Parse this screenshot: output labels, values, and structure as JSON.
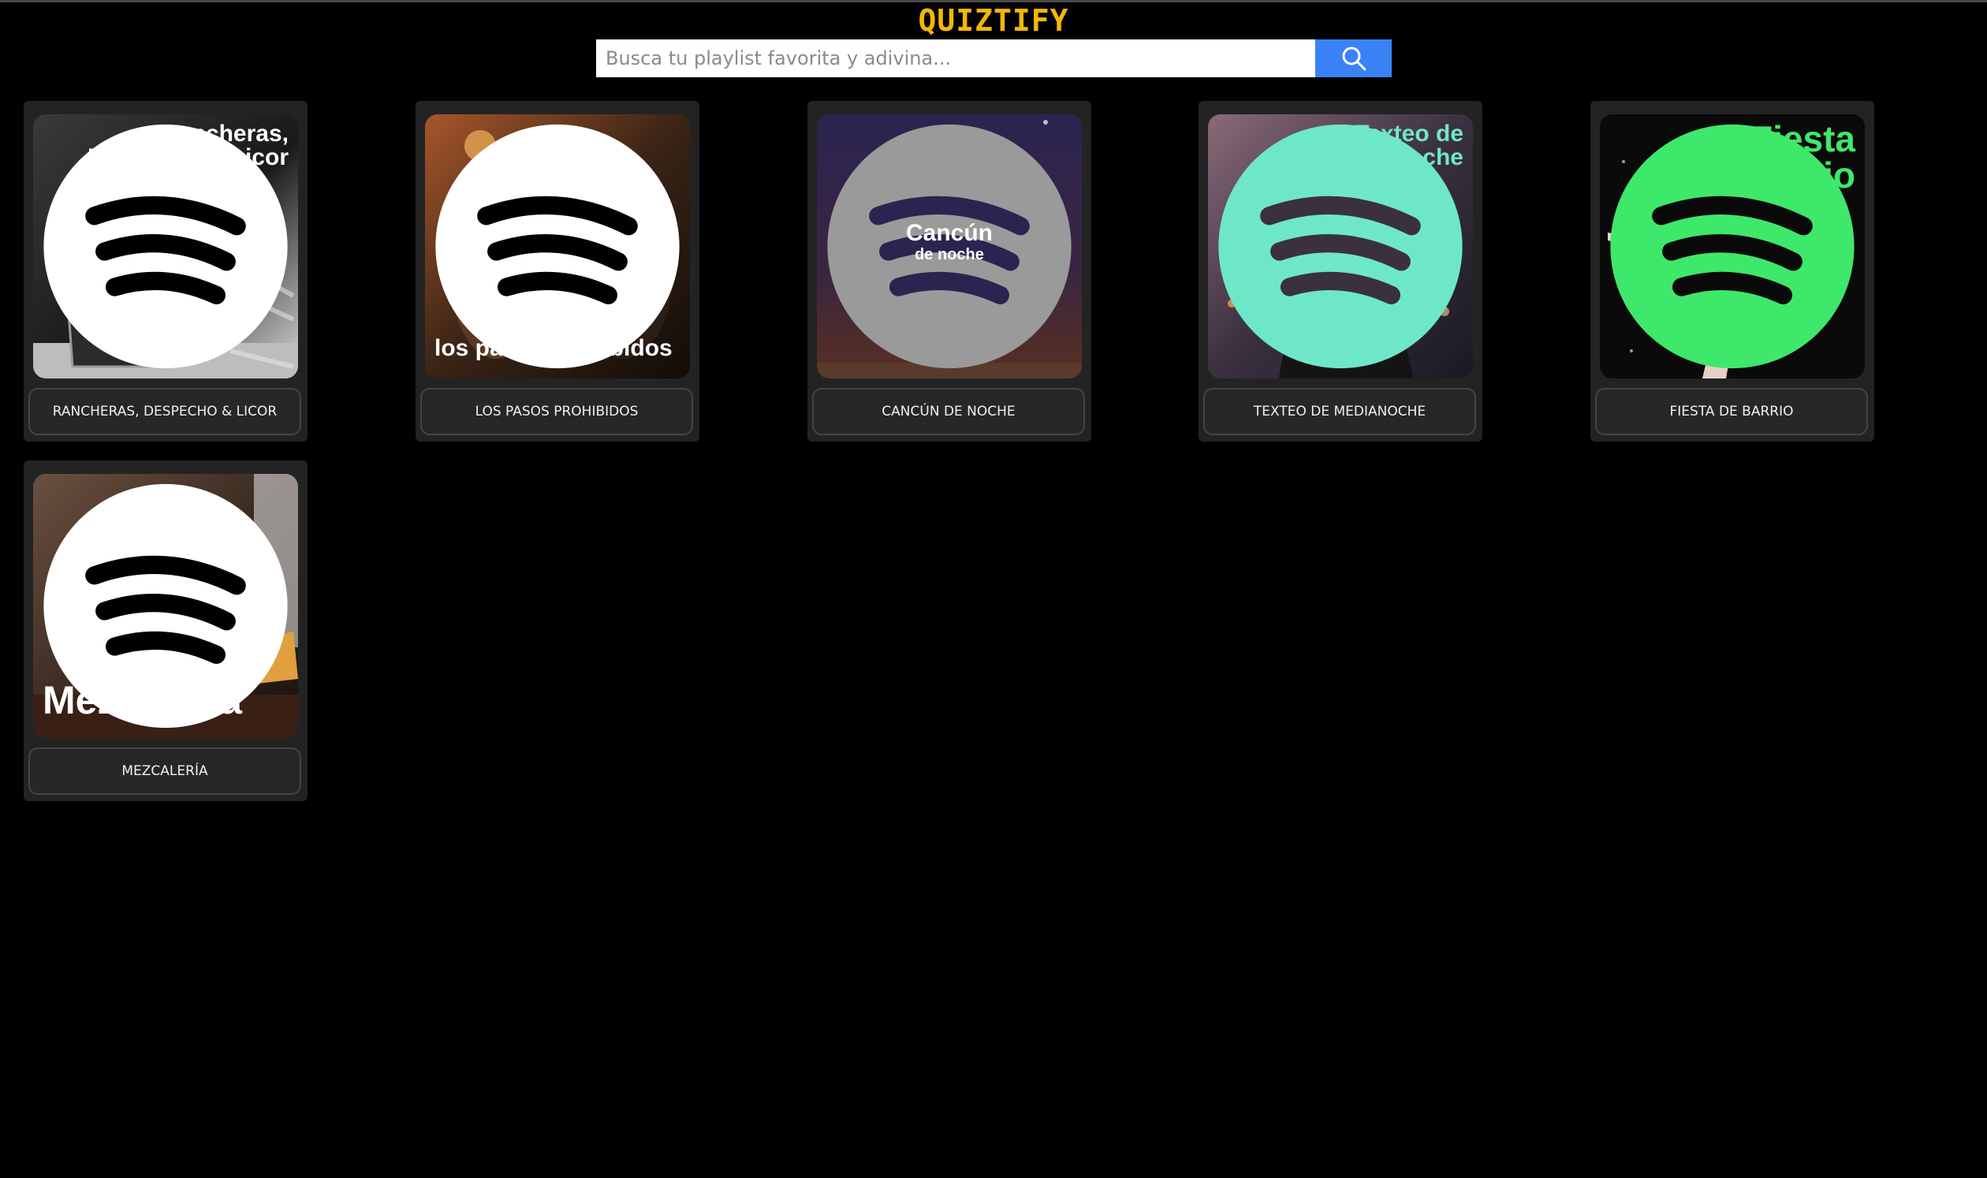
{
  "app": {
    "title": "QUIZTIFY"
  },
  "search": {
    "placeholder": "Busca tu playlist favorita y adivina...",
    "value": "",
    "button_icon": "search-icon"
  },
  "colors": {
    "logo": "#f5b800",
    "search_button": "#3b82f6",
    "card_bg": "#232323",
    "page_bg": "#000000"
  },
  "playlists": [
    {
      "cover_title_line1": "Rancheras,",
      "cover_title_line2": "Despecho & Licor",
      "cover_title_color": "#ffffff",
      "label": "RANCHERAS, DESPECHO & LICOR",
      "icon": "spotify-icon"
    },
    {
      "cover_title_line1": "los pasos prohibidos",
      "cover_title_line2": "",
      "cover_title_color": "#ffffff",
      "label": "LOS PASOS PROHIBIDOS",
      "icon": "spotify-icon"
    },
    {
      "cover_title_line1": "Cancún",
      "cover_title_line2": "de noche",
      "cover_title_color": "#ffffff",
      "label": "CANCÚN DE NOCHE",
      "icon": "spotify-icon"
    },
    {
      "cover_title_line1": "Texteo de",
      "cover_title_line2": "Medianoche",
      "cover_title_color": "#6ee7c8",
      "label": "TEXTEO DE MEDIANOCHE",
      "icon": "spotify-icon"
    },
    {
      "cover_title_line1": "Fiesta",
      "cover_title_line2": "de Barrio",
      "cover_title_color": "#3ee86a",
      "label": "FIESTA DE BARRIO",
      "icon": "spotify-icon"
    },
    {
      "cover_title_line1": "Mezcalería",
      "cover_title_line2": "",
      "cover_title_color": "#ffffff",
      "label": "MEZCALERÍA",
      "icon": "spotify-icon"
    }
  ]
}
